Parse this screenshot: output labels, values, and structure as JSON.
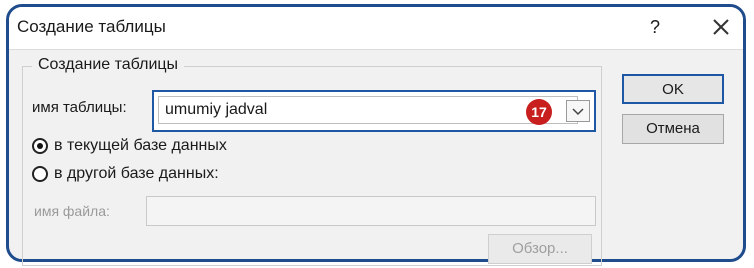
{
  "dialog": {
    "title": "Создание таблицы",
    "help_label": "?",
    "close_icon": "close-icon"
  },
  "group": {
    "legend": "Создание таблицы",
    "name_label": "имя таблицы:",
    "name_value": "umumiy jadval",
    "marker": "17",
    "radio_current_label": "в текущей базе данных",
    "radio_other_label": "в другой базе данных:",
    "radio_selected": "current",
    "file_label": "имя файла:",
    "file_value": ""
  },
  "buttons": {
    "ok_label": "OK",
    "cancel_label": "Отмена",
    "browse_label": "Обзор..."
  },
  "colors": {
    "frame_border": "#1f4c8c",
    "marker_fill": "#c81e1e"
  }
}
